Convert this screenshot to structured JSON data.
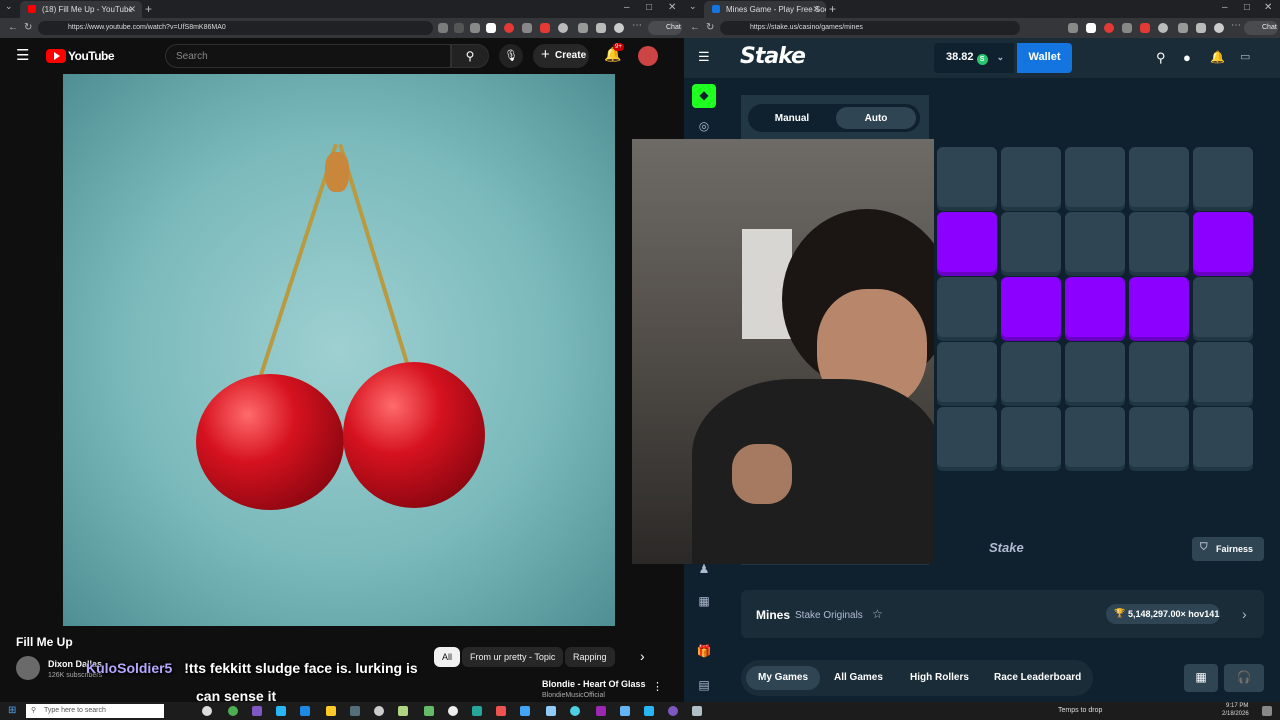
{
  "left_browser": {
    "tab_title": "(18) Fill Me Up - YouTube",
    "url": "https://www.youtube.com/watch?v=UfS8mK86MA0",
    "chat_label": "Chat"
  },
  "youtube": {
    "logo_text": "YouTube",
    "search_placeholder": "Search",
    "create_label": "Create",
    "notification_count": "9+",
    "video_title": "Fill Me Up",
    "channel_name": "Dixon Dallas",
    "subscribers": "126K subscribers",
    "chips": [
      "All",
      "From ur pretty - Topic",
      "Rapping"
    ],
    "rec_title": "Blondie - Heart Of Glass",
    "rec_channel": "BlondieMusicOfficial"
  },
  "stream_overlay": {
    "chat_username": "KuloSoldier5",
    "chat_message_1": "!tts fekkitt sludge face is. lurking is",
    "chat_message_2": "can sense it"
  },
  "right_browser": {
    "tab_title": "Mines Game - Play Free Social Ca",
    "url": "https://stake.us/casino/games/mines",
    "chat_label": "Chat"
  },
  "stake": {
    "logo": "Stake",
    "balance": "38.82",
    "currency_symbol": "S",
    "wallet_label": "Wallet",
    "mode_manual": "Manual",
    "mode_auto": "Auto",
    "grid_cols": 5,
    "grid_rows": 5,
    "gems": [
      [
        1,
        0
      ],
      [
        1,
        4
      ],
      [
        2,
        1
      ],
      [
        2,
        2
      ],
      [
        2,
        3
      ]
    ],
    "footer_logo": "Stake",
    "fairness_label": "Fairness",
    "game_title": "Mines",
    "game_subtitle": "Stake Originals",
    "big_win": "5,148,297.00× hov141",
    "tabs": [
      "My Games",
      "All Games",
      "High Rollers",
      "Race Leaderboard"
    ],
    "gem_color": "#8b00ff",
    "accent_blue": "#1475e1"
  },
  "taskbar": {
    "search_placeholder": "Type here to search",
    "weather": "Temps to drop",
    "time": "9:17 PM",
    "date": "2/18/2026"
  }
}
